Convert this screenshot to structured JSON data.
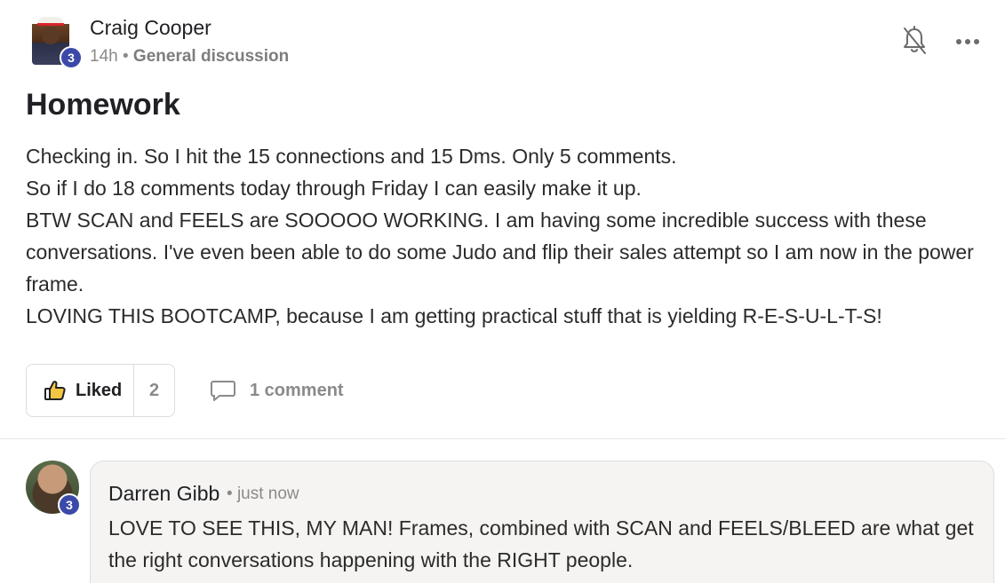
{
  "post": {
    "author": {
      "name": "Craig Cooper",
      "level": "3",
      "avatar_icon": "user-avatar"
    },
    "time": "14h",
    "separator": "•",
    "category": "General discussion",
    "title": "Homework",
    "body": [
      "Checking in. So I hit the 15 connections and 15 Dms. Only 5 comments.",
      "So if I do 18 comments today through Friday I can easily make it up.",
      "BTW SCAN and FEELS are SOOOOO WORKING. I am having some incredible success with these conversations. I've even been able to do some Judo and flip their sales attempt so I am now in the power frame.",
      "LOVING THIS BOOTCAMP, because I am getting practical stuff that is yielding R-E-S-U-L-T-S!"
    ],
    "actions": {
      "like_label": "Liked",
      "like_count": "2",
      "comment_label": "1 comment"
    },
    "icons": {
      "notification": "bell-off-icon",
      "more": "more-horizontal-icon",
      "like": "thumbs-up-icon",
      "comment": "comment-bubble-icon"
    }
  },
  "comment": {
    "author": "Darren Gibb",
    "level": "3",
    "separator": "•",
    "time": "just now",
    "text": "LOVE TO SEE THIS, MY MAN! Frames, combined with SCAN and FEELS/BLEED are what get the right conversations happening with the RIGHT people."
  },
  "colors": {
    "level_badge": "#3b4aa8",
    "meta_text": "#8a8a8a",
    "comment_card_bg": "#f5f4f2"
  }
}
